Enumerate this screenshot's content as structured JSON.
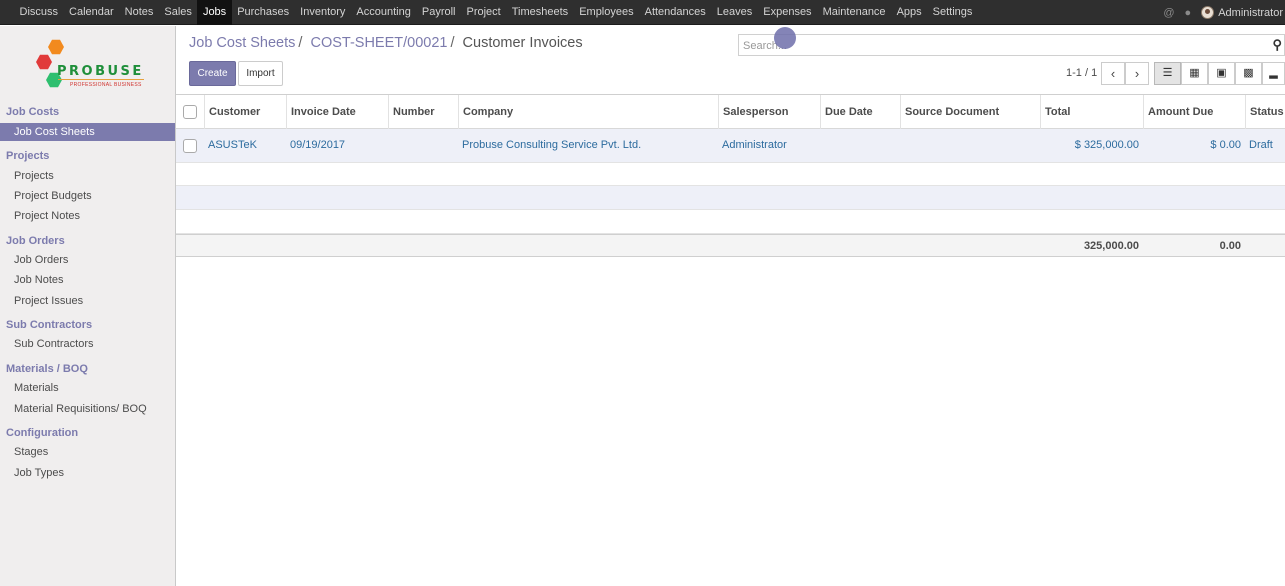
{
  "topbar": {
    "menu": [
      "Discuss",
      "Calendar",
      "Notes",
      "Sales",
      "Jobs",
      "Purchases",
      "Inventory",
      "Accounting",
      "Payroll",
      "Project",
      "Timesheets",
      "Employees",
      "Attendances",
      "Leaves",
      "Expenses",
      "Maintenance",
      "Apps",
      "Settings"
    ],
    "active_menu": "Jobs",
    "user": "Administrator",
    "icons": [
      "at-icon",
      "chat-icon",
      "avatar"
    ]
  },
  "sidebar": {
    "logo_text": "PROBUSE",
    "logo_tagline": "PROFESSIONAL BUSINESS",
    "sections": [
      {
        "title": "Job Costs",
        "items": [
          "Job Cost Sheets"
        ]
      },
      {
        "title": "Projects",
        "items": [
          "Projects",
          "Project Budgets",
          "Project Notes"
        ]
      },
      {
        "title": "Job Orders",
        "items": [
          "Job Orders",
          "Job Notes",
          "Project Issues"
        ]
      },
      {
        "title": "Sub Contractors",
        "items": [
          "Sub Contractors"
        ]
      },
      {
        "title": "Materials / BOQ",
        "items": [
          "Materials",
          "Material Requisitions/ BOQ"
        ]
      },
      {
        "title": "Configuration",
        "items": [
          "Stages",
          "Job Types"
        ]
      }
    ],
    "active_item": "Job Cost Sheets"
  },
  "breadcrumb": {
    "items": [
      "Job Cost Sheets",
      "COST-SHEET/00021"
    ],
    "current": "Customer Invoices"
  },
  "search": {
    "placeholder": "Search..."
  },
  "buttons": {
    "create": "Create",
    "import": "Import"
  },
  "pager": {
    "value": "1-1 / 1",
    "prev_icon": "chevron-left-icon",
    "next_icon": "chevron-right-icon"
  },
  "views": [
    "list-view",
    "kanban-view",
    "calendar-view",
    "pivot-view",
    "graph-view"
  ],
  "active_view": "list-view",
  "table": {
    "columns": [
      "Customer",
      "Invoice Date",
      "Number",
      "Company",
      "Salesperson",
      "Due Date",
      "Source Document",
      "Total",
      "Amount Due",
      "Status"
    ],
    "rows": [
      {
        "customer": "ASUSTeK",
        "invoice_date": "09/19/2017",
        "number": "",
        "company": "Probuse Consulting Service Pvt. Ltd.",
        "salesperson": "Administrator",
        "due_date": "",
        "source_document": "",
        "total": "$ 325,000.00",
        "amount_due": "$ 0.00",
        "status": "Draft"
      }
    ],
    "footer": {
      "total": "325,000.00",
      "amount_due": "0.00"
    }
  },
  "colors": {
    "accent": "#7c7bad",
    "topbar": "#2f2f2f",
    "link": "#2c6b9e"
  }
}
